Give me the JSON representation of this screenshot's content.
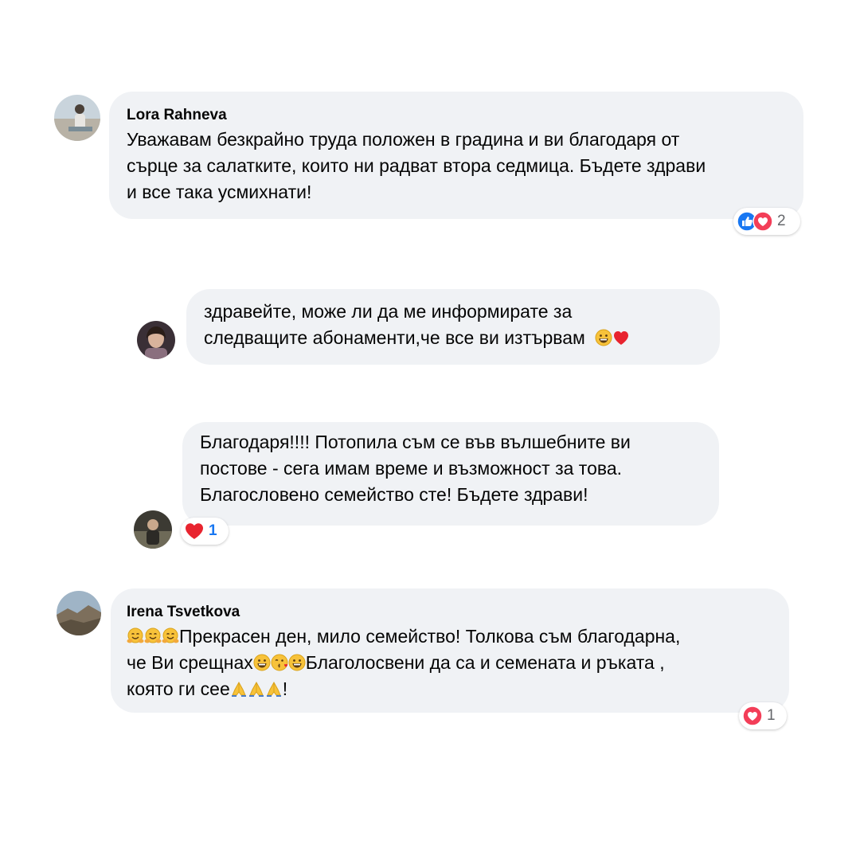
{
  "comments": [
    {
      "author": "Lora Rahneva",
      "lines": [
        "Уважавам безкрайно труда положен в градина и ви благодаря от",
        "сърце за салатките, които ни радват втора седмица. Бъдете здрави",
        "и все така усмихнати!"
      ],
      "reactions": {
        "icons": [
          "like-icon",
          "love-icon"
        ],
        "count": "2"
      }
    },
    {
      "author": "",
      "lines": [
        "здравейте, може ли да ме информирате за",
        "следващите абонаменти,че все ви изтървам"
      ],
      "trailing_emoji": [
        "grinning-face-emoji",
        "red-heart-emoji"
      ]
    },
    {
      "author": "",
      "lines": [
        "Благодаря!!!! Потопила съм се във вълшебните ви",
        "постове - сега имам време и възможност за това.",
        "Благословено семейство сте! Бъдете здрави!"
      ],
      "reactions": {
        "icons": [
          "heart-icon"
        ],
        "count": "1"
      }
    },
    {
      "author": "Irena Tsvetkova",
      "line1_text": "Прекрасен ден, мило семейство! Толкова съм благодарна,",
      "line2_text_a": "че Ви срещнах",
      "line2_text_b": "Благолосвени да са и семената и ръката ,",
      "line3_text_a": "която ги сее",
      "line3_text_b": "!",
      "reactions": {
        "icons": [
          "love-icon"
        ],
        "count": "1"
      }
    }
  ],
  "colors": {
    "bubble": "#f0f2f5",
    "text": "#050505",
    "meta": "#65676b",
    "like_blue": "#1877f2",
    "love_red": "#f33e58"
  }
}
